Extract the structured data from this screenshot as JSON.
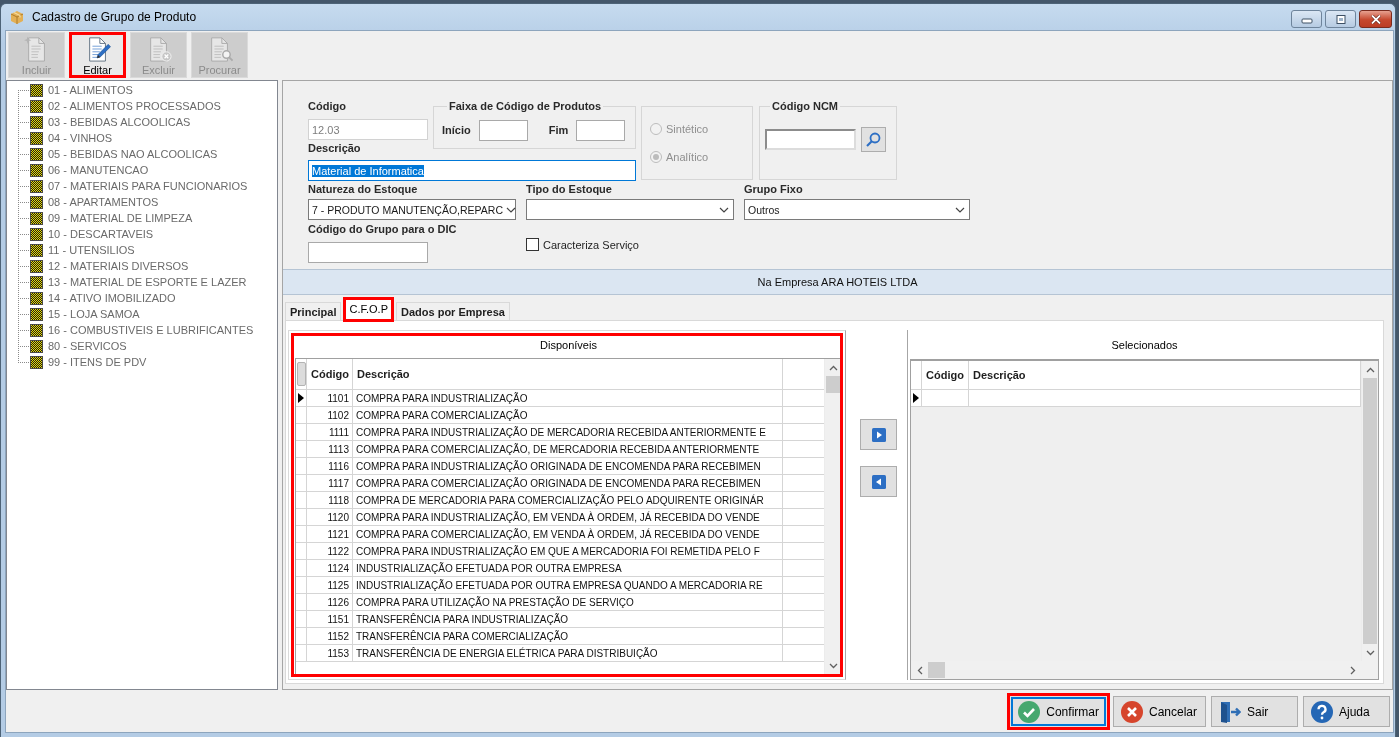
{
  "window": {
    "title": "Cadastro de Grupo de Produto"
  },
  "toolbar": [
    {
      "kind": "new",
      "label": "Incluir",
      "disabled": true,
      "highlighted": false
    },
    {
      "kind": "edit",
      "label": "Editar",
      "disabled": false,
      "highlighted": true
    },
    {
      "kind": "delete",
      "label": "Excluir",
      "disabled": true,
      "highlighted": false
    },
    {
      "kind": "search",
      "label": "Procurar",
      "disabled": true,
      "highlighted": false
    }
  ],
  "group_tree": {
    "items": [
      "01 - ALIMENTOS",
      "02 - ALIMENTOS PROCESSADOS",
      "03 - BEBIDAS ALCOOLICAS",
      "04 - VINHOS",
      "05 - BEBIDAS NAO ALCOOLICAS",
      "06 - MANUTENCAO",
      "07 - MATERIAIS PARA FUNCIONARIOS",
      "08 - APARTAMENTOS",
      "09 - MATERIAL DE LIMPEZA",
      "10 - DESCARTAVEIS",
      "11 - UTENSILIOS",
      "12 - MATERIAIS DIVERSOS",
      "13 - MATERIAL DE ESPORTE E LAZER",
      "14 - ATIVO IMOBILIZADO",
      "15 - LOJA SAMOA",
      "16 - COMBUSTIVEIS E LUBRIFICANTES",
      "80 - SERVICOS",
      "99 - ITENS DE PDV"
    ]
  },
  "form": {
    "code": {
      "label": "Código",
      "value": "12.03",
      "disabled": true
    },
    "product_code_range": {
      "legend": "Faixa de Código de Produtos",
      "start_label": "Início",
      "end_label": "Fim"
    },
    "type_radios": [
      {
        "label": "Sintético",
        "selected": false,
        "disabled": true
      },
      {
        "label": "Analítico",
        "selected": true,
        "disabled": true
      }
    ],
    "ncm": {
      "legend": "Código NCM"
    },
    "description": {
      "label": "Descrição",
      "value": "Material de Informatica",
      "text_selected": true
    },
    "stock_nature": {
      "label": "Natureza do Estoque",
      "value": "7 - PRODUTO MANUTENÇÃO,REPARC"
    },
    "stock_type": {
      "label": "Tipo do Estoque"
    },
    "fixed_group": {
      "label": "Grupo Fixo",
      "value": "Outros"
    },
    "dic_group_code": {
      "label": "Código do Grupo para o DIC"
    },
    "service_flag": {
      "label": "Caracteriza Serviço",
      "checked": false
    }
  },
  "company_banner": {
    "text": "Na Empresa ARA HOTEIS LTDA"
  },
  "tabs": [
    {
      "label": "Principal",
      "selected": false,
      "highlighted": false
    },
    {
      "label": "C.F.O.P",
      "selected": true,
      "highlighted": true
    },
    {
      "label": "Dados por Empresa",
      "selected": false,
      "highlighted": false
    }
  ],
  "available": {
    "title": "Disponíveis",
    "highlighted": true,
    "columns": [
      "Código",
      "Descrição"
    ],
    "rows": [
      {
        "code": "1101",
        "description": "COMPRA PARA INDUSTRIALIZAÇÃO",
        "current": true
      },
      {
        "code": "1102",
        "description": "COMPRA PARA COMERCIALIZAÇÃO",
        "current": false
      },
      {
        "code": "1111",
        "description": "COMPRA PARA INDUSTRIALIZAÇÃO DE MERCADORIA RECEBIDA ANTERIORMENTE E",
        "current": false
      },
      {
        "code": "1113",
        "description": "COMPRA PARA COMERCIALIZAÇÃO, DE MERCADORIA RECEBIDA ANTERIORMENTE",
        "current": false
      },
      {
        "code": "1116",
        "description": "COMPRA PARA INDUSTRIALIZAÇÃO ORIGINADA DE ENCOMENDA PARA RECEBIMEN",
        "current": false
      },
      {
        "code": "1117",
        "description": "COMPRA PARA COMERCIALIZAÇÃO ORIGINADA DE ENCOMENDA PARA RECEBIMEN",
        "current": false
      },
      {
        "code": "1118",
        "description": "COMPRA DE MERCADORIA PARA COMERCIALIZAÇÃO PELO ADQUIRENTE ORIGINÁR",
        "current": false
      },
      {
        "code": "1120",
        "description": "COMPRA PARA INDUSTRIALIZAÇÃO, EM VENDA À ORDEM, JÁ RECEBIDA DO VENDE",
        "current": false
      },
      {
        "code": "1121",
        "description": "COMPRA PARA COMERCIALIZAÇÃO, EM VENDA À ORDEM, JÁ RECEBIDA DO VENDE",
        "current": false
      },
      {
        "code": "1122",
        "description": "COMPRA PARA INDUSTRIALIZAÇÃO EM QUE A MERCADORIA FOI REMETIDA PELO F",
        "current": false
      },
      {
        "code": "1124",
        "description": "INDUSTRIALIZAÇÃO EFETUADA POR OUTRA EMPRESA",
        "current": false
      },
      {
        "code": "1125",
        "description": "INDUSTRIALIZAÇÃO EFETUADA POR OUTRA EMPRESA QUANDO A MERCADORIA RE",
        "current": false
      },
      {
        "code": "1126",
        "description": "COMPRA PARA UTILIZAÇÃO NA PRESTAÇÃO DE SERVIÇO",
        "current": false
      },
      {
        "code": "1151",
        "description": "TRANSFERÊNCIA PARA INDUSTRIALIZAÇÃO",
        "current": false
      },
      {
        "code": "1152",
        "description": "TRANSFERÊNCIA PARA COMERCIALIZAÇÃO",
        "current": false
      },
      {
        "code": "1153",
        "description": "TRANSFERÊNCIA DE ENERGIA ELÉTRICA PARA DISTRIBUIÇÃO",
        "current": false
      }
    ]
  },
  "selected_list": {
    "title": "Selecionados",
    "columns": [
      "Código",
      "Descrição"
    ],
    "rows": [
      {
        "current": true
      }
    ]
  },
  "footer_buttons": [
    {
      "kind": "confirm",
      "label": "Confirmar",
      "focused": true,
      "highlighted": true
    },
    {
      "kind": "cancel",
      "label": "Cancelar",
      "focused": false,
      "highlighted": false
    },
    {
      "kind": "exit",
      "label": "Sair",
      "focused": false,
      "highlighted": false
    },
    {
      "kind": "help",
      "label": "Ajuda",
      "focused": false,
      "highlighted": false
    }
  ]
}
